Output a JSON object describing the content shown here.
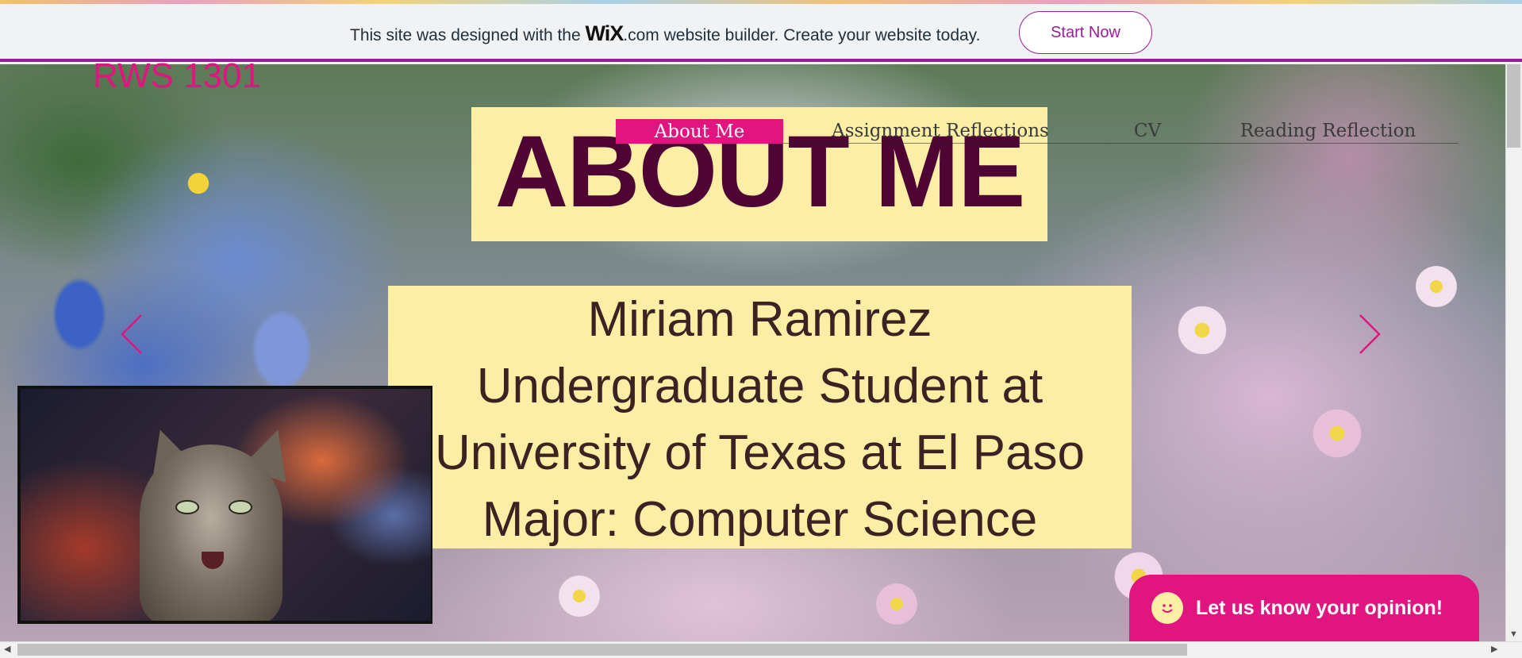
{
  "banner": {
    "text_before": "This site was designed with the",
    "logo": "WiX",
    "logo_suffix": ".com",
    "text_after": "website builder. Create your website today.",
    "cta_label": "Start Now",
    "accent": "#9c1d9a"
  },
  "site": {
    "title": "RWS 1301",
    "brand_color": "#e0157f"
  },
  "nav": {
    "items": [
      {
        "label": "About Me",
        "active": true
      },
      {
        "label": "Assignment Reflections",
        "active": false
      },
      {
        "label": "CV",
        "active": false
      },
      {
        "label": "Reading Reflection",
        "active": false
      }
    ]
  },
  "hero": {
    "heading": "ABOUT ME",
    "bio_lines": [
      "Miriam Ramirez",
      "Undergraduate Student at",
      "University of Texas at El Paso",
      "Major: Computer Science"
    ],
    "panel_color": "#fdeea6",
    "prev_icon": "chevron-left-icon",
    "next_icon": "chevron-right-icon"
  },
  "chat": {
    "label": "Let us know your opinion!",
    "icon": "smiley-icon"
  }
}
